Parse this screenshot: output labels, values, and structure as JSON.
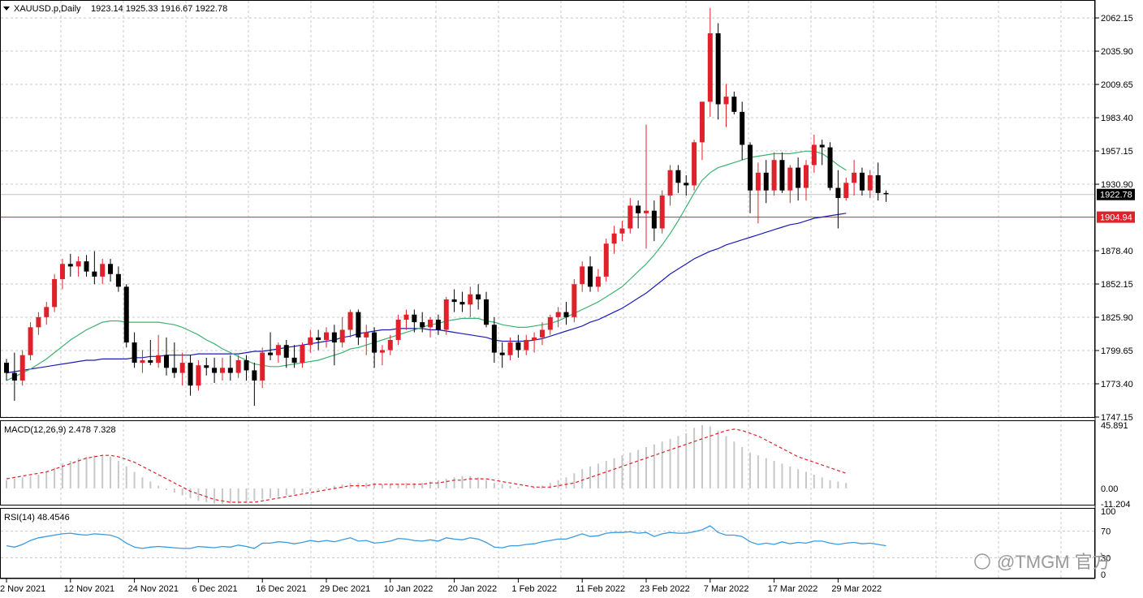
{
  "header": {
    "symbol": "XAUUSD.p,Daily",
    "ohlc": "1923.14 1925.33 1916.67 1922.78",
    "macd_label": "MACD(12,26,9) 2.478 7.328",
    "rsi_label": "RSI(14) 48.4546"
  },
  "watermark": "@TMGM 官方",
  "colors": {
    "bull": "#e0202a",
    "bear": "#000000",
    "ma_fast": "#3cb371",
    "ma_slow": "#1c1cb4",
    "support": "#e0202a",
    "current": "#c0c0c0",
    "macd_signal": "#e0202a",
    "macd_hist": "#c8c8c8",
    "rsi": "#3a9be0",
    "grid": "#c8c8c8"
  },
  "chart_data": {
    "type": "candlestick",
    "price_axis": {
      "ylim": [
        1747.15,
        2075.0
      ],
      "ticks": [
        "2062.15",
        "2035.90",
        "2009.65",
        "1983.40",
        "1957.15",
        "1930.90",
        "1904.94",
        "1878.40",
        "1852.15",
        "1825.90",
        "1799.65",
        "1773.40",
        "1747.15"
      ],
      "current_price": 1922.78,
      "current_price_label": "1922.78",
      "support_level": 1904.94,
      "support_label": "1904.94"
    },
    "x_axis": {
      "labels": [
        "2 Nov 2021",
        "12 Nov 2021",
        "24 Nov 2021",
        "6 Dec 2021",
        "16 Dec 2021",
        "29 Dec 2021",
        "10 Jan 2022",
        "20 Jan 2022",
        "1 Feb 2022",
        "11 Feb 2022",
        "23 Feb 2022",
        "7 Mar 2022",
        "17 Mar 2022",
        "29 Mar 2022"
      ],
      "label_index": [
        0,
        8,
        16,
        24,
        32,
        40,
        48,
        56,
        64,
        72,
        80,
        88,
        96,
        104
      ]
    },
    "candles": [
      [
        1790,
        1793,
        1776,
        1782
      ],
      [
        1782,
        1798,
        1760,
        1776
      ],
      [
        1776,
        1800,
        1772,
        1796
      ],
      [
        1796,
        1822,
        1792,
        1818
      ],
      [
        1818,
        1830,
        1812,
        1826
      ],
      [
        1826,
        1838,
        1820,
        1834
      ],
      [
        1834,
        1860,
        1830,
        1856
      ],
      [
        1856,
        1872,
        1848,
        1868
      ],
      [
        1868,
        1876,
        1858,
        1866
      ],
      [
        1866,
        1874,
        1858,
        1870
      ],
      [
        1870,
        1875,
        1858,
        1862
      ],
      [
        1862,
        1878,
        1852,
        1858
      ],
      [
        1858,
        1872,
        1852,
        1868
      ],
      [
        1868,
        1872,
        1854,
        1860
      ],
      [
        1860,
        1866,
        1846,
        1850
      ],
      [
        1850,
        1852,
        1802,
        1806
      ],
      [
        1806,
        1814,
        1786,
        1790
      ],
      [
        1790,
        1800,
        1782,
        1792
      ],
      [
        1792,
        1808,
        1788,
        1790
      ],
      [
        1790,
        1812,
        1786,
        1796
      ],
      [
        1796,
        1810,
        1780,
        1786
      ],
      [
        1786,
        1806,
        1778,
        1782
      ],
      [
        1782,
        1798,
        1772,
        1790
      ],
      [
        1790,
        1796,
        1764,
        1772
      ],
      [
        1772,
        1792,
        1768,
        1788
      ],
      [
        1788,
        1794,
        1780,
        1786
      ],
      [
        1786,
        1794,
        1774,
        1782
      ],
      [
        1782,
        1794,
        1776,
        1786
      ],
      [
        1786,
        1796,
        1776,
        1782
      ],
      [
        1782,
        1796,
        1778,
        1792
      ],
      [
        1792,
        1796,
        1776,
        1784
      ],
      [
        1784,
        1790,
        1756,
        1776
      ],
      [
        1776,
        1802,
        1770,
        1798
      ],
      [
        1798,
        1814,
        1792,
        1796
      ],
      [
        1796,
        1806,
        1790,
        1804
      ],
      [
        1804,
        1808,
        1786,
        1794
      ],
      [
        1794,
        1804,
        1786,
        1790
      ],
      [
        1790,
        1806,
        1786,
        1804
      ],
      [
        1804,
        1816,
        1798,
        1810
      ],
      [
        1810,
        1816,
        1800,
        1808
      ],
      [
        1808,
        1818,
        1802,
        1814
      ],
      [
        1814,
        1820,
        1788,
        1806
      ],
      [
        1806,
        1826,
        1802,
        1816
      ],
      [
        1816,
        1832,
        1810,
        1830
      ],
      [
        1830,
        1832,
        1804,
        1810
      ],
      [
        1810,
        1820,
        1796,
        1814
      ],
      [
        1814,
        1818,
        1786,
        1798
      ],
      [
        1798,
        1804,
        1788,
        1800
      ],
      [
        1800,
        1812,
        1796,
        1808
      ],
      [
        1808,
        1828,
        1804,
        1824
      ],
      [
        1824,
        1832,
        1816,
        1828
      ],
      [
        1828,
        1832,
        1814,
        1822
      ],
      [
        1822,
        1830,
        1814,
        1818
      ],
      [
        1818,
        1826,
        1810,
        1824
      ],
      [
        1824,
        1828,
        1812,
        1816
      ],
      [
        1816,
        1842,
        1812,
        1840
      ],
      [
        1840,
        1848,
        1830,
        1838
      ],
      [
        1838,
        1846,
        1830,
        1836
      ],
      [
        1836,
        1850,
        1826,
        1844
      ],
      [
        1844,
        1852,
        1832,
        1840
      ],
      [
        1840,
        1846,
        1818,
        1820
      ],
      [
        1820,
        1826,
        1790,
        1798
      ],
      [
        1798,
        1806,
        1786,
        1796
      ],
      [
        1796,
        1810,
        1792,
        1806
      ],
      [
        1806,
        1812,
        1794,
        1800
      ],
      [
        1800,
        1812,
        1796,
        1808
      ],
      [
        1808,
        1814,
        1798,
        1810
      ],
      [
        1810,
        1822,
        1804,
        1816
      ],
      [
        1816,
        1828,
        1812,
        1826
      ],
      [
        1826,
        1834,
        1818,
        1830
      ],
      [
        1830,
        1838,
        1820,
        1826
      ],
      [
        1826,
        1856,
        1822,
        1852
      ],
      [
        1852,
        1870,
        1846,
        1866
      ],
      [
        1866,
        1874,
        1846,
        1850
      ],
      [
        1850,
        1864,
        1846,
        1858
      ],
      [
        1858,
        1888,
        1854,
        1884
      ],
      [
        1884,
        1898,
        1876,
        1892
      ],
      [
        1892,
        1902,
        1886,
        1896
      ],
      [
        1896,
        1920,
        1892,
        1914
      ],
      [
        1914,
        1918,
        1896,
        1908
      ],
      [
        1908,
        1978,
        1880,
        1910
      ],
      [
        1910,
        1918,
        1886,
        1896
      ],
      [
        1896,
        1926,
        1892,
        1922
      ],
      [
        1922,
        1946,
        1914,
        1942
      ],
      [
        1942,
        1946,
        1924,
        1932
      ],
      [
        1932,
        1938,
        1922,
        1930
      ],
      [
        1930,
        1966,
        1926,
        1964
      ],
      [
        1964,
        1996,
        1950,
        1996
      ],
      [
        1996,
        2070,
        1984,
        2050
      ],
      [
        2050,
        2058,
        1982,
        1994
      ],
      [
        1994,
        2010,
        1976,
        2000
      ],
      [
        2000,
        2004,
        1986,
        1988
      ],
      [
        1988,
        1996,
        1950,
        1962
      ],
      [
        1962,
        1964,
        1908,
        1926
      ],
      [
        1926,
        1948,
        1900,
        1940
      ],
      [
        1940,
        1950,
        1916,
        1926
      ],
      [
        1926,
        1956,
        1922,
        1950
      ],
      [
        1950,
        1956,
        1924,
        1926
      ],
      [
        1926,
        1946,
        1916,
        1944
      ],
      [
        1944,
        1952,
        1918,
        1928
      ],
      [
        1928,
        1950,
        1918,
        1946
      ],
      [
        1946,
        1970,
        1940,
        1962
      ],
      [
        1962,
        1966,
        1946,
        1960
      ],
      [
        1960,
        1964,
        1926,
        1928
      ],
      [
        1928,
        1942,
        1896,
        1920
      ],
      [
        1920,
        1936,
        1918,
        1932
      ],
      [
        1932,
        1950,
        1922,
        1940
      ],
      [
        1940,
        1944,
        1922,
        1926
      ],
      [
        1926,
        1942,
        1920,
        1938
      ],
      [
        1938,
        1948,
        1918,
        1924
      ],
      [
        1924,
        1926,
        1917,
        1923
      ]
    ],
    "ma_fast": [
      1776,
      1779,
      1782,
      1785,
      1789,
      1793,
      1798,
      1803,
      1808,
      1812,
      1816,
      1819,
      1822,
      1823,
      1823,
      1822,
      1822,
      1822,
      1822,
      1822,
      1821,
      1820,
      1818,
      1815,
      1812,
      1808,
      1805,
      1801,
      1798,
      1795,
      1792,
      1789,
      1788,
      1787,
      1787,
      1788,
      1789,
      1790,
      1791,
      1792,
      1794,
      1796,
      1798,
      1801,
      1802,
      1804,
      1806,
      1808,
      1810,
      1812,
      1814,
      1816,
      1818,
      1820,
      1821,
      1823,
      1824,
      1825,
      1825,
      1825,
      1823,
      1822,
      1820,
      1819,
      1818,
      1818,
      1819,
      1820,
      1821,
      1823,
      1826,
      1829,
      1832,
      1835,
      1838,
      1842,
      1846,
      1850,
      1856,
      1862,
      1868,
      1875,
      1883,
      1892,
      1902,
      1913,
      1924,
      1934,
      1940,
      1944,
      1946,
      1948,
      1950,
      1952,
      1953,
      1954,
      1955,
      1955,
      1955,
      1956,
      1957,
      1957,
      1955,
      1951,
      1946,
      1942
    ],
    "ma_slow": [
      1782,
      1783,
      1784,
      1785,
      1786,
      1787,
      1788,
      1789,
      1790,
      1791,
      1792,
      1792,
      1793,
      1793,
      1793,
      1793,
      1794,
      1794,
      1795,
      1795,
      1796,
      1796,
      1796,
      1796,
      1797,
      1797,
      1797,
      1797,
      1797,
      1797,
      1798,
      1799,
      1799,
      1800,
      1801,
      1802,
      1803,
      1804,
      1805,
      1806,
      1807,
      1808,
      1810,
      1811,
      1813,
      1814,
      1815,
      1816,
      1816,
      1817,
      1817,
      1817,
      1817,
      1816,
      1816,
      1815,
      1814,
      1813,
      1812,
      1811,
      1810,
      1808,
      1807,
      1807,
      1807,
      1807,
      1808,
      1809,
      1811,
      1813,
      1815,
      1817,
      1819,
      1822,
      1824,
      1827,
      1830,
      1833,
      1837,
      1841,
      1845,
      1850,
      1855,
      1860,
      1864,
      1868,
      1872,
      1875,
      1878,
      1880,
      1883,
      1885,
      1887,
      1889,
      1891,
      1893,
      1895,
      1897,
      1899,
      1900,
      1902,
      1904,
      1905,
      1906,
      1907,
      1908
    ],
    "macd": {
      "label_ticks": [
        "45.891",
        "0.00",
        "-11.204"
      ],
      "ylim": [
        -11.204,
        45.891
      ],
      "histogram": [
        6,
        7,
        8,
        9,
        10,
        12,
        15,
        18,
        20,
        22,
        23,
        24,
        24,
        23,
        20,
        16,
        12,
        8,
        5,
        2,
        -1,
        -3,
        -5,
        -7,
        -9,
        -10,
        -11,
        -11,
        -11,
        -11,
        -10,
        -9,
        -8,
        -7,
        -6,
        -5,
        -4,
        -3,
        -2,
        -1,
        1,
        2,
        3,
        4,
        4,
        4,
        4,
        3,
        3,
        3,
        4,
        4,
        4,
        5,
        6,
        7,
        8,
        9,
        9,
        8,
        6,
        4,
        3,
        2,
        1,
        0,
        1,
        2,
        4,
        6,
        8,
        11,
        14,
        16,
        18,
        20,
        22,
        24,
        26,
        28,
        30,
        32,
        34,
        36,
        38,
        40,
        44,
        46,
        45,
        42,
        38,
        34,
        30,
        26,
        24,
        22,
        20,
        18,
        16,
        14,
        12,
        10,
        8,
        6,
        5,
        4
      ],
      "signal": [
        7,
        8,
        9,
        10,
        11,
        12,
        14,
        16,
        18,
        20,
        22,
        23,
        24,
        24,
        23,
        21,
        19,
        16,
        13,
        10,
        7,
        4,
        1,
        -2,
        -4,
        -6,
        -8,
        -9,
        -10,
        -10,
        -10,
        -10,
        -9,
        -8,
        -7,
        -6,
        -5,
        -4,
        -3,
        -2,
        -1,
        0,
        1,
        2,
        2,
        2,
        3,
        3,
        3,
        3,
        3,
        3,
        3,
        4,
        4,
        5,
        6,
        6,
        7,
        7,
        7,
        6,
        5,
        4,
        3,
        2,
        1,
        1,
        1,
        2,
        3,
        4,
        6,
        8,
        10,
        12,
        14,
        16,
        18,
        20,
        22,
        24,
        26,
        28,
        30,
        32,
        34,
        36,
        38,
        40,
        42,
        43,
        42,
        40,
        38,
        35,
        32,
        29,
        26,
        23,
        21,
        19,
        17,
        15,
        13,
        11
      ]
    },
    "rsi": {
      "label_ticks": [
        "100",
        "70",
        "30",
        "0"
      ],
      "ylim": [
        0,
        100
      ],
      "values": [
        48,
        46,
        50,
        56,
        60,
        62,
        64,
        66,
        67,
        65,
        64,
        66,
        65,
        64,
        60,
        52,
        46,
        44,
        46,
        47,
        46,
        45,
        44,
        44,
        47,
        46,
        45,
        47,
        46,
        49,
        47,
        44,
        52,
        52,
        54,
        53,
        51,
        53,
        56,
        54,
        56,
        54,
        57,
        60,
        55,
        56,
        52,
        53,
        55,
        59,
        58,
        56,
        55,
        57,
        55,
        60,
        58,
        57,
        60,
        58,
        53,
        46,
        45,
        48,
        48,
        50,
        51,
        54,
        56,
        58,
        58,
        62,
        66,
        62,
        63,
        67,
        68,
        68,
        69,
        67,
        68,
        62,
        66,
        68,
        67,
        67,
        69,
        72,
        78,
        68,
        64,
        64,
        62,
        54,
        50,
        52,
        50,
        54,
        51,
        53,
        52,
        55,
        55,
        52,
        50,
        52,
        53,
        51,
        52,
        50,
        48
      ]
    }
  }
}
